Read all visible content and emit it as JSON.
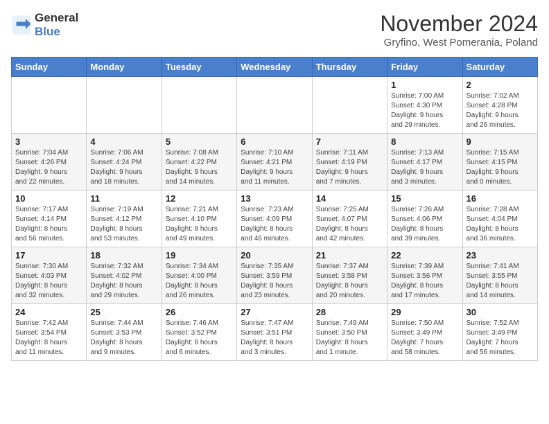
{
  "header": {
    "logo_line1": "General",
    "logo_line2": "Blue",
    "month_year": "November 2024",
    "location": "Gryfino, West Pomerania, Poland"
  },
  "days_of_week": [
    "Sunday",
    "Monday",
    "Tuesday",
    "Wednesday",
    "Thursday",
    "Friday",
    "Saturday"
  ],
  "weeks": [
    [
      {
        "day": "",
        "info": ""
      },
      {
        "day": "",
        "info": ""
      },
      {
        "day": "",
        "info": ""
      },
      {
        "day": "",
        "info": ""
      },
      {
        "day": "",
        "info": ""
      },
      {
        "day": "1",
        "info": "Sunrise: 7:00 AM\nSunset: 4:30 PM\nDaylight: 9 hours\nand 29 minutes."
      },
      {
        "day": "2",
        "info": "Sunrise: 7:02 AM\nSunset: 4:28 PM\nDaylight: 9 hours\nand 26 minutes."
      }
    ],
    [
      {
        "day": "3",
        "info": "Sunrise: 7:04 AM\nSunset: 4:26 PM\nDaylight: 9 hours\nand 22 minutes."
      },
      {
        "day": "4",
        "info": "Sunrise: 7:06 AM\nSunset: 4:24 PM\nDaylight: 9 hours\nand 18 minutes."
      },
      {
        "day": "5",
        "info": "Sunrise: 7:08 AM\nSunset: 4:22 PM\nDaylight: 9 hours\nand 14 minutes."
      },
      {
        "day": "6",
        "info": "Sunrise: 7:10 AM\nSunset: 4:21 PM\nDaylight: 9 hours\nand 11 minutes."
      },
      {
        "day": "7",
        "info": "Sunrise: 7:11 AM\nSunset: 4:19 PM\nDaylight: 9 hours\nand 7 minutes."
      },
      {
        "day": "8",
        "info": "Sunrise: 7:13 AM\nSunset: 4:17 PM\nDaylight: 9 hours\nand 3 minutes."
      },
      {
        "day": "9",
        "info": "Sunrise: 7:15 AM\nSunset: 4:15 PM\nDaylight: 9 hours\nand 0 minutes."
      }
    ],
    [
      {
        "day": "10",
        "info": "Sunrise: 7:17 AM\nSunset: 4:14 PM\nDaylight: 8 hours\nand 56 minutes."
      },
      {
        "day": "11",
        "info": "Sunrise: 7:19 AM\nSunset: 4:12 PM\nDaylight: 8 hours\nand 53 minutes."
      },
      {
        "day": "12",
        "info": "Sunrise: 7:21 AM\nSunset: 4:10 PM\nDaylight: 8 hours\nand 49 minutes."
      },
      {
        "day": "13",
        "info": "Sunrise: 7:23 AM\nSunset: 4:09 PM\nDaylight: 8 hours\nand 46 minutes."
      },
      {
        "day": "14",
        "info": "Sunrise: 7:25 AM\nSunset: 4:07 PM\nDaylight: 8 hours\nand 42 minutes."
      },
      {
        "day": "15",
        "info": "Sunrise: 7:26 AM\nSunset: 4:06 PM\nDaylight: 8 hours\nand 39 minutes."
      },
      {
        "day": "16",
        "info": "Sunrise: 7:28 AM\nSunset: 4:04 PM\nDaylight: 8 hours\nand 36 minutes."
      }
    ],
    [
      {
        "day": "17",
        "info": "Sunrise: 7:30 AM\nSunset: 4:03 PM\nDaylight: 8 hours\nand 32 minutes."
      },
      {
        "day": "18",
        "info": "Sunrise: 7:32 AM\nSunset: 4:02 PM\nDaylight: 8 hours\nand 29 minutes."
      },
      {
        "day": "19",
        "info": "Sunrise: 7:34 AM\nSunset: 4:00 PM\nDaylight: 8 hours\nand 26 minutes."
      },
      {
        "day": "20",
        "info": "Sunrise: 7:35 AM\nSunset: 3:59 PM\nDaylight: 8 hours\nand 23 minutes."
      },
      {
        "day": "21",
        "info": "Sunrise: 7:37 AM\nSunset: 3:58 PM\nDaylight: 8 hours\nand 20 minutes."
      },
      {
        "day": "22",
        "info": "Sunrise: 7:39 AM\nSunset: 3:56 PM\nDaylight: 8 hours\nand 17 minutes."
      },
      {
        "day": "23",
        "info": "Sunrise: 7:41 AM\nSunset: 3:55 PM\nDaylight: 8 hours\nand 14 minutes."
      }
    ],
    [
      {
        "day": "24",
        "info": "Sunrise: 7:42 AM\nSunset: 3:54 PM\nDaylight: 8 hours\nand 11 minutes."
      },
      {
        "day": "25",
        "info": "Sunrise: 7:44 AM\nSunset: 3:53 PM\nDaylight: 8 hours\nand 9 minutes."
      },
      {
        "day": "26",
        "info": "Sunrise: 7:46 AM\nSunset: 3:52 PM\nDaylight: 8 hours\nand 6 minutes."
      },
      {
        "day": "27",
        "info": "Sunrise: 7:47 AM\nSunset: 3:51 PM\nDaylight: 8 hours\nand 3 minutes."
      },
      {
        "day": "28",
        "info": "Sunrise: 7:49 AM\nSunset: 3:50 PM\nDaylight: 8 hours\nand 1 minute."
      },
      {
        "day": "29",
        "info": "Sunrise: 7:50 AM\nSunset: 3:49 PM\nDaylight: 7 hours\nand 58 minutes."
      },
      {
        "day": "30",
        "info": "Sunrise: 7:52 AM\nSunset: 3:49 PM\nDaylight: 7 hours\nand 56 minutes."
      }
    ]
  ]
}
